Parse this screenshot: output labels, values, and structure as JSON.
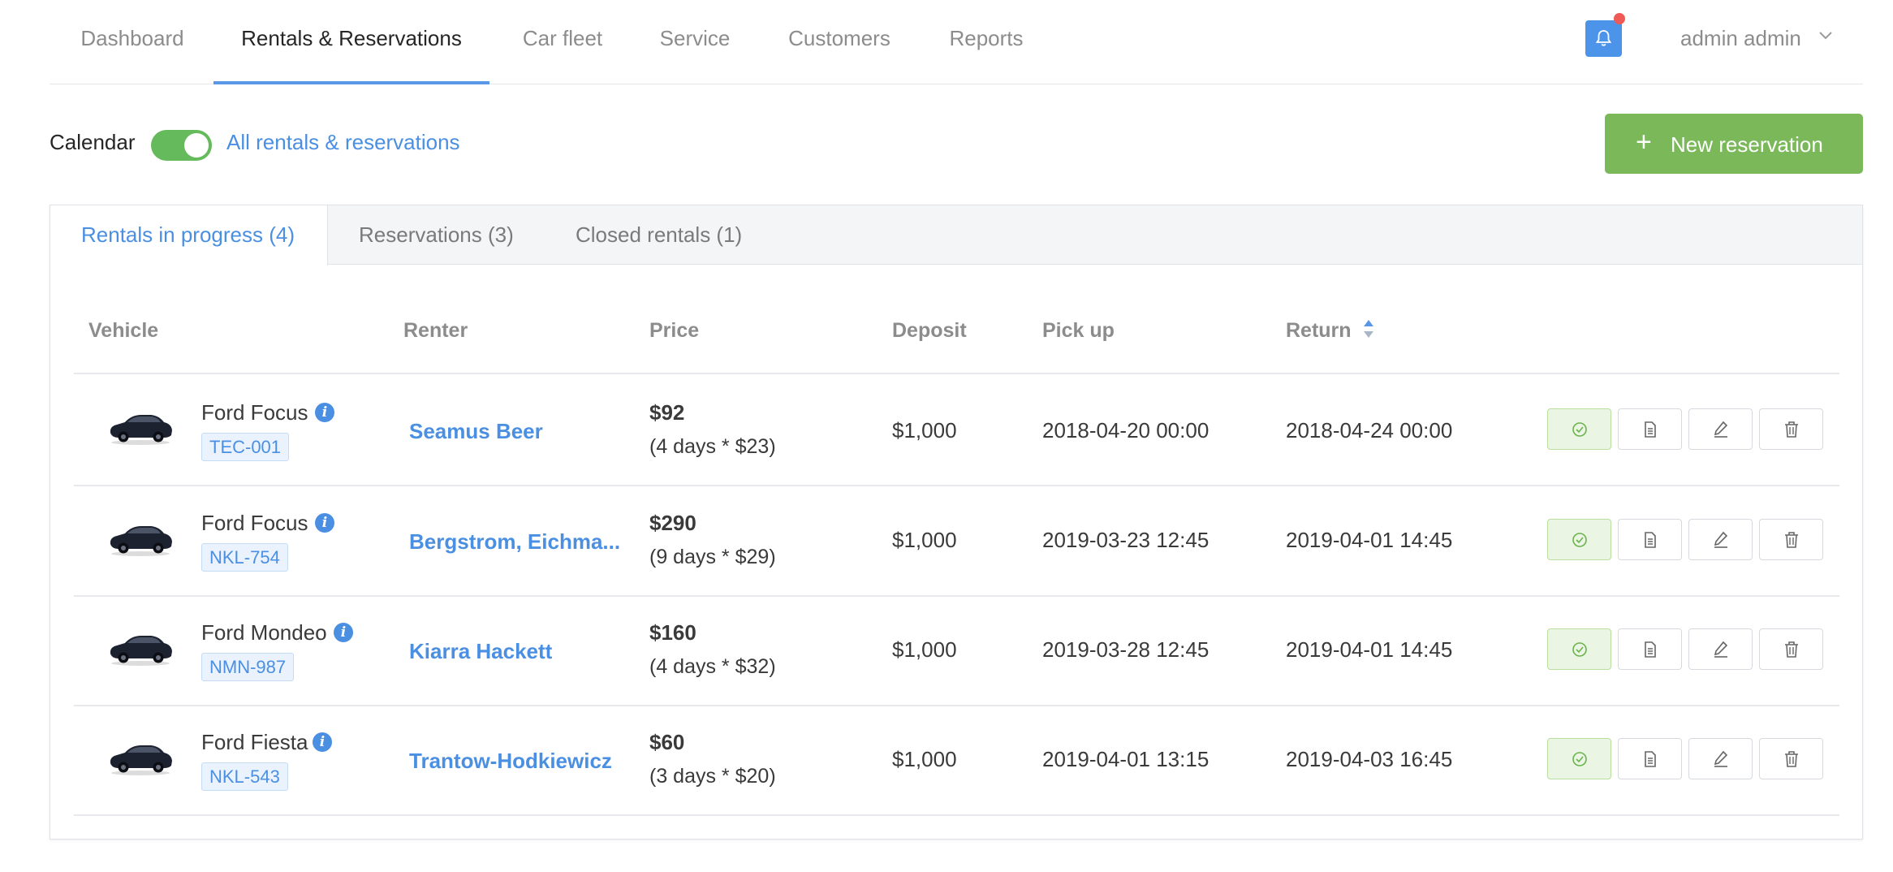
{
  "nav": {
    "items": [
      {
        "label": "Dashboard"
      },
      {
        "label": "Rentals & Reservations",
        "active": true
      },
      {
        "label": "Car fleet"
      },
      {
        "label": "Service"
      },
      {
        "label": "Customers"
      },
      {
        "label": "Reports"
      }
    ],
    "user": "admin admin",
    "notification_icon": "bell-icon"
  },
  "toolbar": {
    "calendar_label": "Calendar",
    "toggle_on": true,
    "all_link": "All rentals & reservations",
    "new_button": "New reservation"
  },
  "tabs": [
    {
      "label": "Rentals in progress (4)",
      "active": true
    },
    {
      "label": "Reservations (3)"
    },
    {
      "label": "Closed rentals (1)"
    }
  ],
  "table": {
    "headers": {
      "vehicle": "Vehicle",
      "renter": "Renter",
      "price": "Price",
      "deposit": "Deposit",
      "pickup": "Pick up",
      "return": "Return"
    },
    "sorted_by": "Return",
    "rows": [
      {
        "model": "Ford Focus",
        "plate": "TEC-001",
        "renter": "Seamus Beer",
        "price": "$92",
        "calc": "(4 days * $23)",
        "deposit": "$1,000",
        "pickup": "2018-04-20 00:00",
        "return": "2018-04-24 00:00"
      },
      {
        "model": "Ford Focus",
        "plate": "NKL-754",
        "renter": "Bergstrom, Eichma...",
        "price": "$290",
        "calc": "(9 days * $29)",
        "deposit": "$1,000",
        "pickup": "2019-03-23 12:45",
        "return": "2019-04-01 14:45"
      },
      {
        "model": "Ford Mondeo",
        "plate": "NMN-987",
        "renter": "Kiarra Hackett",
        "price": "$160",
        "calc": "(4 days * $32)",
        "deposit": "$1,000",
        "pickup": "2019-03-28 12:45",
        "return": "2019-04-01 14:45"
      },
      {
        "model": "Ford Fiesta",
        "plate": "NKL-543",
        "renter": "Trantow-Hodkiewicz",
        "price": "$60",
        "calc": "(3 days * $20)",
        "deposit": "$1,000",
        "pickup": "2019-04-01 13:15",
        "return": "2019-04-03 16:45"
      }
    ],
    "row_actions": [
      "check-circle-icon",
      "document-icon",
      "edit-icon",
      "trash-icon"
    ]
  },
  "colors": {
    "accent": "#4a8fe2",
    "success": "#65bb5c",
    "new_button": "#7ab85a",
    "badge": "#ef5a56"
  }
}
